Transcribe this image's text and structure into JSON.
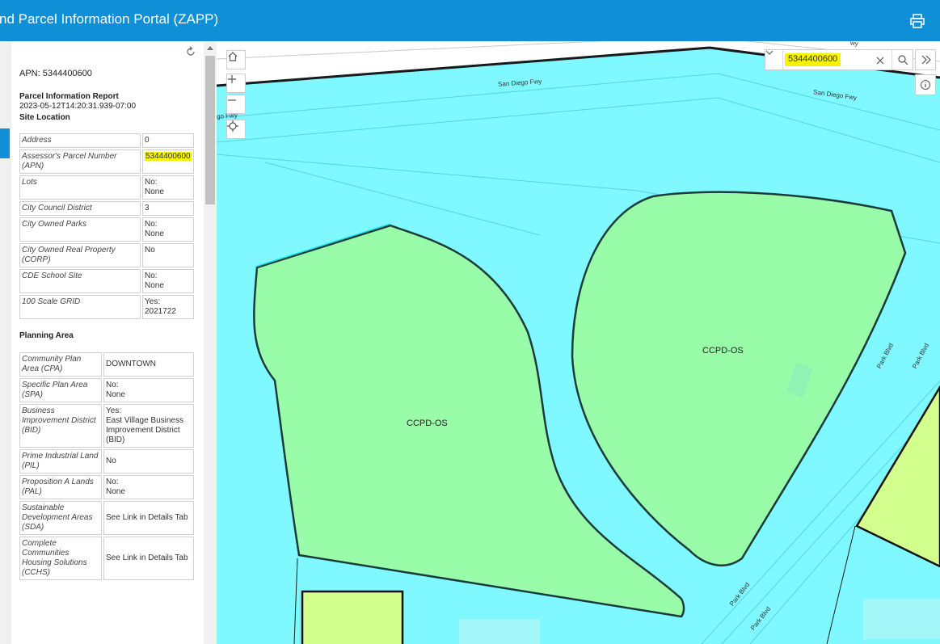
{
  "header": {
    "title": "nd Parcel Information Portal (ZAPP)",
    "print_icon": "printer-icon"
  },
  "panel": {
    "apn_line": "APN: 5344400600",
    "report_title": "Parcel Information Report",
    "report_date": "2023-05-12T14:20:31.939-07:00",
    "site_location_heading": "Site Location",
    "site_rows": [
      {
        "key": "Address",
        "value": "0"
      },
      {
        "key": "Assessor's Parcel Number (APN)",
        "value": "5344400600"
      },
      {
        "key": "Lots",
        "value": "No:\nNone"
      },
      {
        "key": "City Council District",
        "value": "3"
      },
      {
        "key": "City Owned Parks",
        "value": "No:\nNone"
      },
      {
        "key": "City Owned Real Property (CORP)",
        "value": "No"
      },
      {
        "key": "CDE School Site",
        "value": "No:\nNone"
      },
      {
        "key": "100 Scale GRID",
        "value": "Yes:\n2021722"
      }
    ],
    "planning_heading": "Planning Area",
    "planning_rows": [
      {
        "key": "Community Plan Area (CPA)",
        "value": "DOWNTOWN"
      },
      {
        "key": "Specific Plan Area (SPA)",
        "value": "No:\nNone"
      },
      {
        "key": "Business Improvement District (BID)",
        "value": "Yes:\nEast Village Business Improvement District (BID)"
      },
      {
        "key": "Prime Industrial Land (PIL)",
        "value": "No"
      },
      {
        "key": "Proposition A Lands (PAL)",
        "value": "No:\nNone"
      },
      {
        "key": "Sustainable Development Areas (SDA)",
        "value": "See Link in Details Tab"
      },
      {
        "key": "Complete Communities Housing Solutions (CCHS)",
        "value": "See Link in Details Tab"
      }
    ]
  },
  "map": {
    "zone_labels": [
      "CCPD-OS",
      "CCPD-OS"
    ],
    "roads": {
      "fwy1": "San Diego Fwy",
      "fwy2": "San Diego Fwy",
      "fwy3": "go Fwy",
      "fwy4": "wy",
      "park1": "Park Blvd",
      "park2": "Park Blvd",
      "park3": "Park Blvd",
      "park4": "Park Blvd"
    },
    "search": {
      "value": "5344400600"
    },
    "colors": {
      "water": "#7ff8ff",
      "zone_green": "#98fca8",
      "parcel_yellow": "#d3ff8e",
      "header": "#0f8fd6",
      "highlight": "#f7f200"
    }
  }
}
